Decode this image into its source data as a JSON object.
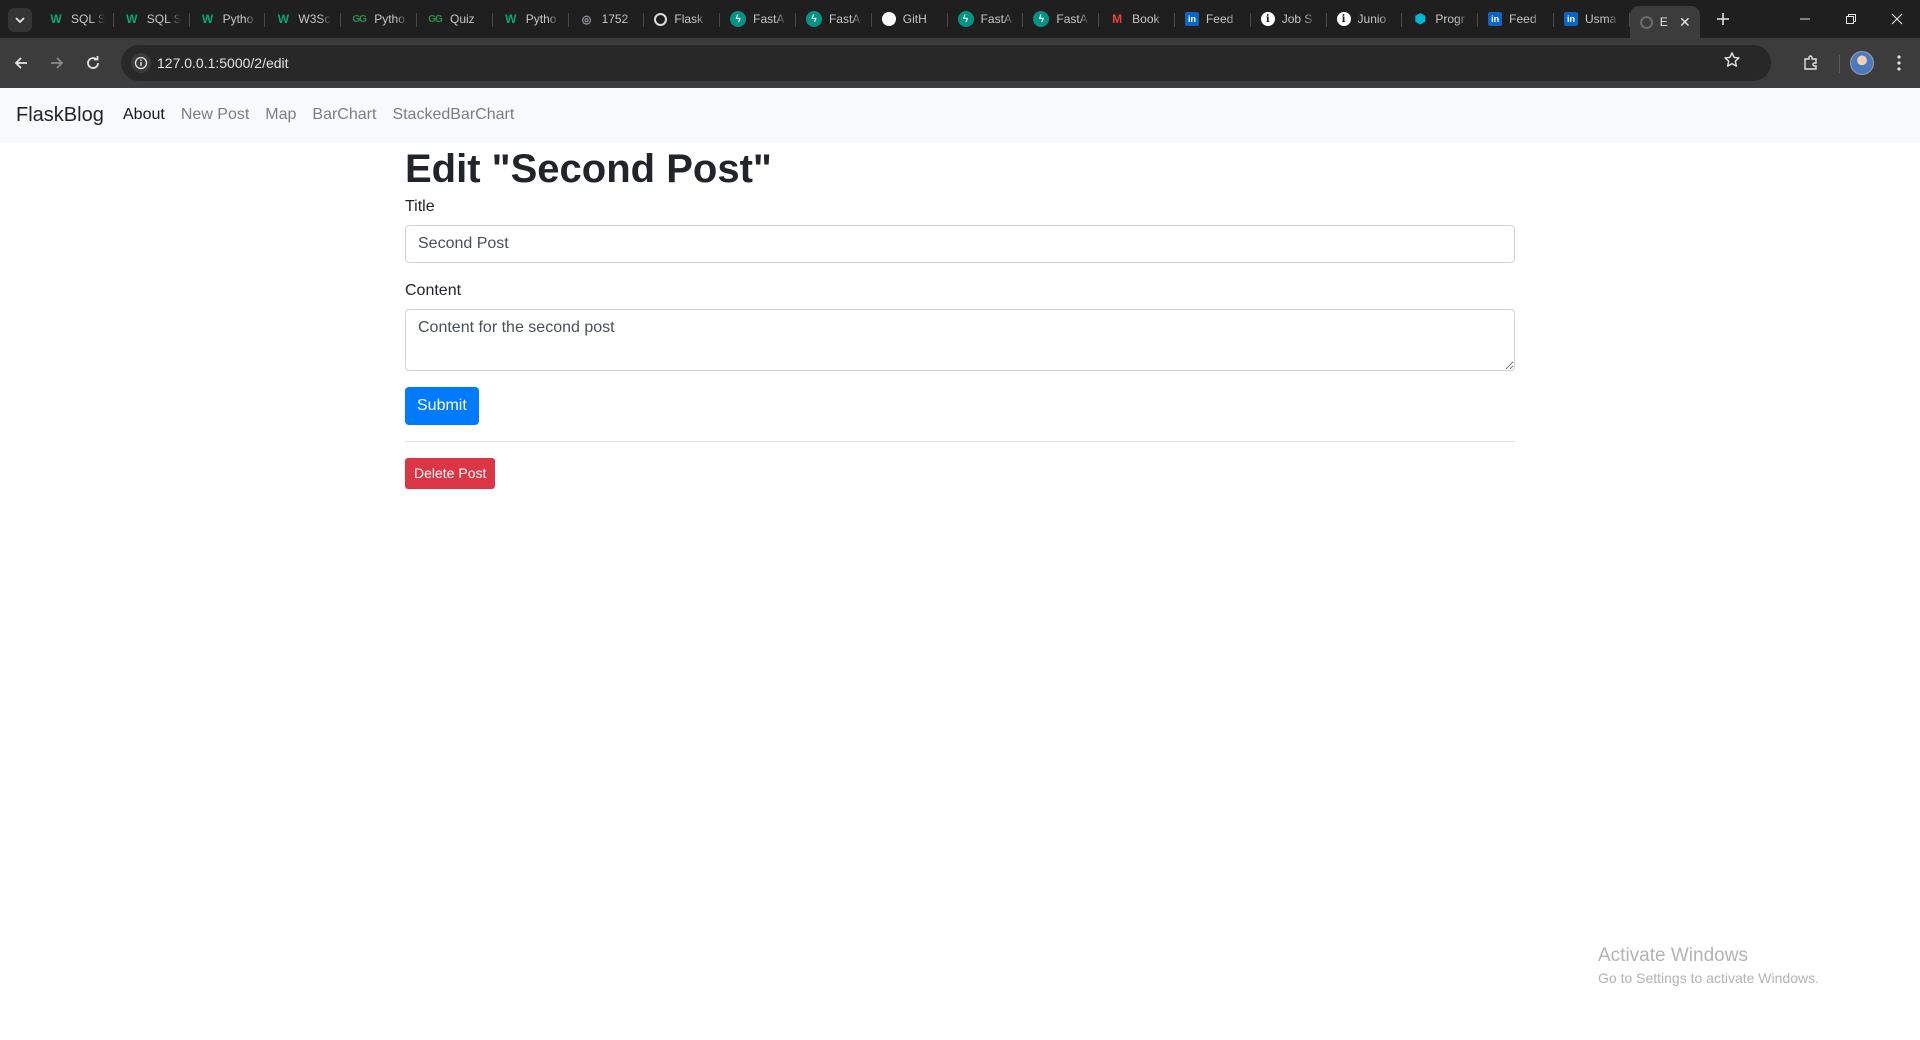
{
  "browser": {
    "tabs": [
      {
        "favicon": "w3schools-icon",
        "title": "SQL S"
      },
      {
        "favicon": "w3schools-icon",
        "title": "SQL S"
      },
      {
        "favicon": "w3schools-icon",
        "title": "Pytho"
      },
      {
        "favicon": "w3schools-icon",
        "title": "W3Sc"
      },
      {
        "favicon": "geeksforgeeks-icon",
        "title": "Pytho"
      },
      {
        "favicon": "geeksforgeeks-icon",
        "title": "Quiz"
      },
      {
        "favicon": "w3schools-icon",
        "title": "Pytho"
      },
      {
        "favicon": "globe-icon",
        "title": "1752"
      },
      {
        "favicon": "flask-icon",
        "title": "Flask"
      },
      {
        "favicon": "fastapi-icon",
        "title": "FastA"
      },
      {
        "favicon": "fastapi-icon",
        "title": "FastA"
      },
      {
        "favicon": "github-icon",
        "title": "GitH"
      },
      {
        "favicon": "fastapi-icon",
        "title": "FastA"
      },
      {
        "favicon": "fastapi-icon",
        "title": "FastA"
      },
      {
        "favicon": "gmail-icon",
        "title": "Book"
      },
      {
        "favicon": "linkedin-icon",
        "title": "Feed"
      },
      {
        "favicon": "info-icon",
        "title": "Job S"
      },
      {
        "favicon": "info-icon",
        "title": "Junio"
      },
      {
        "favicon": "programiz-icon",
        "title": "Progr"
      },
      {
        "favicon": "linkedin-icon",
        "title": "Feed"
      },
      {
        "favicon": "linkedin-icon",
        "title": "Usma"
      }
    ],
    "active_tab": {
      "favicon": "loading-icon",
      "title": "E"
    },
    "url": "127.0.0.1:5000/2/edit"
  },
  "navbar": {
    "brand": "FlaskBlog",
    "links": [
      {
        "label": "About",
        "active": true
      },
      {
        "label": "New Post",
        "active": false
      },
      {
        "label": "Map",
        "active": false
      },
      {
        "label": "BarChart",
        "active": false
      },
      {
        "label": "StackedBarChart",
        "active": false
      }
    ]
  },
  "form": {
    "heading": "Edit \"Second Post\"",
    "title_label": "Title",
    "title_value": "Second Post",
    "content_label": "Content",
    "content_value": "Content for the second post",
    "submit_label": "Submit",
    "delete_label": "Delete Post"
  },
  "watermark": {
    "title": "Activate Windows",
    "subtitle": "Go to Settings to activate Windows."
  },
  "colors": {
    "primary": "#007bff",
    "danger": "#dc3545",
    "navbar_bg": "#f8f9fa",
    "chrome_dark": "#1f1f1f"
  }
}
